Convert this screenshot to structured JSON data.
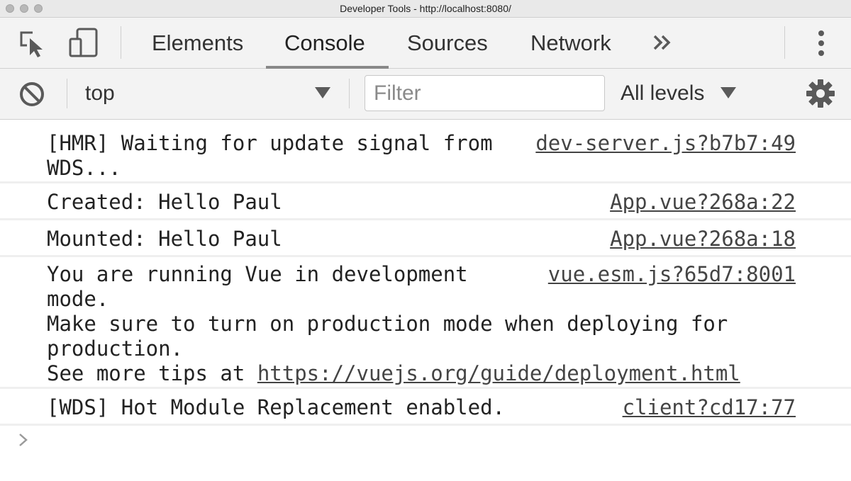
{
  "window": {
    "title": "Developer Tools - http://localhost:8080/"
  },
  "tabs": [
    {
      "label": "Elements"
    },
    {
      "label": "Console"
    },
    {
      "label": "Sources"
    },
    {
      "label": "Network"
    }
  ],
  "tabbar": {
    "more_icon": "chevrons-right-icon",
    "menu_icon": "vertical-dots-icon"
  },
  "toolbar": {
    "context_value": "top",
    "filter_placeholder": "Filter",
    "levels_label": "All levels"
  },
  "messages": [
    {
      "text": "[HMR] Waiting for update signal from\nWDS...",
      "source": "dev-server.js?b7b7:49"
    },
    {
      "text": "Created: Hello Paul",
      "source": "App.vue?268a:22"
    },
    {
      "text": "Mounted: Hello Paul",
      "source": "App.vue?268a:18"
    },
    {
      "text_pre": "You are running Vue in development\nmode.\nMake sure to turn on production mode when deploying for\nproduction.\nSee more tips at ",
      "link": "https://vuejs.org/guide/deployment.html",
      "source": "vue.esm.js?65d7:8001"
    },
    {
      "text": "[WDS] Hot Module Replacement enabled.",
      "source": "client?cd17:77"
    }
  ]
}
